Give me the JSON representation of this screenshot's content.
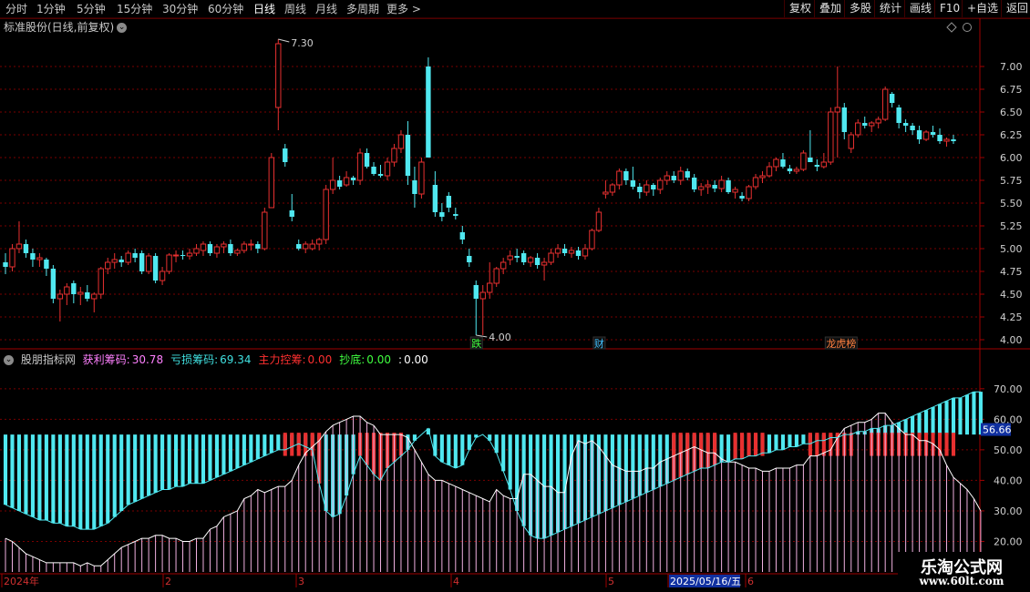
{
  "toolbar": {
    "periods": [
      "分时",
      "1分钟",
      "5分钟",
      "15分钟",
      "30分钟",
      "60分钟",
      "日线",
      "周线",
      "月线",
      "多周期",
      "更多 >"
    ],
    "active_index": 6,
    "right_buttons": [
      "复权",
      "叠加",
      "多股",
      "统计",
      "画线",
      "F10",
      "+自选",
      "返回"
    ]
  },
  "stock": {
    "title": "标准股份(日线,前复权)"
  },
  "indicator": {
    "name": "股朋指标网",
    "items": [
      {
        "label": "获利筹码:",
        "value": "30.78",
        "color": "#ff80ff"
      },
      {
        "label": "亏损筹码:",
        "value": "69.34",
        "color": "#40e0e0"
      },
      {
        "label": "主力控筹:",
        "value": "0.00",
        "color": "#ff3030"
      },
      {
        "label": "抄底:",
        "value": "0.00",
        "color": "#40ff40"
      },
      {
        "label": ":",
        "value": "0.00",
        "color": "#ffffff"
      }
    ],
    "current_value_tag": "56.66"
  },
  "markers": {
    "max_label": "7.30",
    "min_label": "4.00"
  },
  "event_tags": [
    {
      "text": "跌",
      "color": "#40ff40"
    },
    {
      "text": "财",
      "color": "#40c0ff"
    },
    {
      "text": "龙虎榜",
      "color": "#ff8040"
    }
  ],
  "time_axis": {
    "labels": [
      "2024年",
      "2",
      "3",
      "4",
      "5",
      "2025/05/16/五",
      "6"
    ]
  },
  "watermark": {
    "title": "乐淘公式网",
    "url": "www.60lt.com"
  },
  "chart_data": [
    {
      "type": "candlestick",
      "title": "标准股份(日线,前复权)",
      "y_ticks": [
        4.0,
        4.25,
        4.5,
        4.75,
        5.0,
        5.25,
        5.5,
        5.75,
        6.0,
        6.25,
        6.5,
        6.75,
        7.0
      ],
      "ylim": [
        3.93,
        7.35
      ],
      "candles": [
        [
          4.85,
          4.95,
          4.72,
          4.8
        ],
        [
          4.8,
          5.05,
          4.75,
          5.0
        ],
        [
          5.0,
          5.3,
          4.95,
          5.05
        ],
        [
          5.05,
          5.1,
          4.9,
          4.95
        ],
        [
          4.95,
          5.0,
          4.8,
          4.88
        ],
        [
          4.88,
          4.95,
          4.8,
          4.9
        ],
        [
          4.88,
          4.9,
          4.7,
          4.78
        ],
        [
          4.78,
          4.82,
          4.4,
          4.45
        ],
        [
          4.45,
          4.55,
          4.2,
          4.5
        ],
        [
          4.5,
          4.62,
          4.38,
          4.58
        ],
        [
          4.62,
          4.65,
          4.4,
          4.5
        ],
        [
          4.5,
          4.58,
          4.38,
          4.52
        ],
        [
          4.52,
          4.6,
          4.42,
          4.45
        ],
        [
          4.45,
          4.52,
          4.3,
          4.5
        ],
        [
          4.5,
          4.8,
          4.45,
          4.78
        ],
        [
          4.78,
          4.9,
          4.72,
          4.85
        ],
        [
          4.85,
          4.95,
          4.78,
          4.88
        ],
        [
          4.88,
          4.92,
          4.8,
          4.85
        ],
        [
          4.85,
          4.98,
          4.82,
          4.95
        ],
        [
          4.95,
          5.0,
          4.85,
          4.9
        ],
        [
          4.95,
          4.98,
          4.72,
          4.75
        ],
        [
          4.75,
          4.95,
          4.72,
          4.92
        ],
        [
          4.92,
          4.95,
          4.62,
          4.65
        ],
        [
          4.65,
          4.8,
          4.6,
          4.75
        ],
        [
          4.75,
          4.95,
          4.72,
          4.93
        ],
        [
          4.92,
          4.98,
          4.85,
          4.93
        ],
        [
          4.93,
          4.98,
          4.88,
          4.92
        ],
        [
          4.92,
          5.0,
          4.88,
          4.95
        ],
        [
          4.95,
          5.05,
          4.92,
          5.0
        ],
        [
          4.98,
          5.08,
          4.92,
          5.05
        ],
        [
          5.05,
          5.08,
          4.92,
          4.95
        ],
        [
          4.95,
          5.05,
          4.9,
          5.02
        ],
        [
          5.02,
          5.08,
          4.95,
          5.05
        ],
        [
          5.05,
          5.1,
          4.92,
          4.95
        ],
        [
          4.95,
          5.0,
          4.92,
          4.98
        ],
        [
          4.98,
          5.08,
          4.95,
          5.05
        ],
        [
          5.05,
          5.1,
          4.98,
          5.05
        ],
        [
          5.05,
          5.08,
          4.95,
          5.0
        ],
        [
          5.0,
          5.45,
          4.98,
          5.4
        ],
        [
          5.45,
          6.05,
          5.45,
          6.0
        ],
        [
          6.55,
          7.3,
          6.3,
          7.25
        ],
        [
          6.1,
          6.15,
          5.9,
          5.95
        ],
        [
          5.42,
          5.6,
          5.3,
          5.35
        ],
        [
          5.05,
          5.1,
          4.98,
          5.0
        ],
        [
          5.0,
          5.08,
          4.95,
          5.05
        ],
        [
          5.0,
          5.1,
          4.98,
          5.05
        ],
        [
          5.05,
          5.12,
          4.98,
          5.1
        ],
        [
          5.1,
          5.7,
          5.05,
          5.65
        ],
        [
          5.65,
          6.0,
          5.6,
          5.75
        ],
        [
          5.75,
          5.8,
          5.65,
          5.68
        ],
        [
          5.7,
          5.85,
          5.68,
          5.78
        ],
        [
          5.78,
          5.8,
          5.7,
          5.75
        ],
        [
          5.75,
          6.1,
          5.7,
          6.05
        ],
        [
          6.05,
          6.1,
          5.88,
          5.9
        ],
        [
          5.9,
          5.95,
          5.8,
          5.82
        ],
        [
          5.82,
          5.92,
          5.78,
          5.8
        ],
        [
          5.8,
          6.0,
          5.75,
          5.95
        ],
        [
          5.95,
          6.15,
          5.9,
          6.1
        ],
        [
          6.1,
          6.3,
          6.05,
          6.25
        ],
        [
          6.25,
          6.4,
          5.7,
          5.8
        ],
        [
          5.75,
          5.9,
          5.45,
          5.6
        ],
        [
          5.6,
          6.0,
          5.55,
          5.95
        ],
        [
          7.0,
          7.1,
          6.0,
          6.0
        ],
        [
          5.7,
          5.85,
          5.35,
          5.4
        ],
        [
          5.4,
          5.5,
          5.3,
          5.35
        ],
        [
          5.58,
          5.62,
          5.4,
          5.45
        ],
        [
          5.38,
          5.45,
          5.32,
          5.36
        ],
        [
          5.18,
          5.25,
          5.05,
          5.1
        ],
        [
          4.92,
          5.0,
          4.8,
          4.85
        ],
        [
          4.6,
          4.65,
          4.05,
          4.45
        ],
        [
          4.45,
          4.6,
          4.05,
          4.52
        ],
        [
          4.52,
          4.85,
          4.45,
          4.62
        ],
        [
          4.62,
          4.8,
          4.58,
          4.78
        ],
        [
          4.78,
          4.9,
          4.72,
          4.85
        ],
        [
          4.88,
          4.98,
          4.82,
          4.92
        ],
        [
          4.92,
          5.0,
          4.85,
          4.9
        ],
        [
          4.95,
          4.98,
          4.82,
          4.85
        ],
        [
          4.85,
          4.92,
          4.8,
          4.9
        ],
        [
          4.9,
          4.95,
          4.78,
          4.82
        ],
        [
          4.82,
          4.9,
          4.65,
          4.85
        ],
        [
          4.85,
          5.0,
          4.82,
          4.95
        ],
        [
          4.95,
          5.05,
          4.9,
          5.0
        ],
        [
          5.0,
          5.05,
          4.92,
          4.95
        ],
        [
          4.95,
          5.02,
          4.9,
          4.98
        ],
        [
          4.98,
          5.02,
          4.88,
          4.92
        ],
        [
          4.92,
          5.05,
          4.88,
          5.0
        ],
        [
          5.0,
          5.22,
          4.98,
          5.2
        ],
        [
          5.2,
          5.45,
          5.18,
          5.4
        ],
        [
          5.6,
          5.75,
          5.55,
          5.62
        ],
        [
          5.62,
          5.72,
          5.58,
          5.7
        ],
        [
          5.7,
          5.88,
          5.65,
          5.85
        ],
        [
          5.85,
          5.88,
          5.7,
          5.75
        ],
        [
          5.75,
          5.9,
          5.65,
          5.68
        ],
        [
          5.68,
          5.72,
          5.55,
          5.62
        ],
        [
          5.62,
          5.75,
          5.58,
          5.7
        ],
        [
          5.7,
          5.72,
          5.58,
          5.65
        ],
        [
          5.65,
          5.78,
          5.6,
          5.75
        ],
        [
          5.75,
          5.85,
          5.7,
          5.8
        ],
        [
          5.8,
          5.85,
          5.72,
          5.75
        ],
        [
          5.75,
          5.9,
          5.7,
          5.85
        ],
        [
          5.85,
          5.88,
          5.75,
          5.78
        ],
        [
          5.78,
          5.82,
          5.62,
          5.65
        ],
        [
          5.65,
          5.72,
          5.58,
          5.68
        ],
        [
          5.68,
          5.75,
          5.6,
          5.7
        ],
        [
          5.7,
          5.75,
          5.62,
          5.66
        ],
        [
          5.66,
          5.8,
          5.62,
          5.75
        ],
        [
          5.75,
          5.78,
          5.6,
          5.62
        ],
        [
          5.62,
          5.68,
          5.55,
          5.65
        ],
        [
          5.58,
          5.62,
          5.52,
          5.55
        ],
        [
          5.55,
          5.7,
          5.52,
          5.68
        ],
        [
          5.68,
          5.82,
          5.65,
          5.78
        ],
        [
          5.78,
          5.85,
          5.72,
          5.8
        ],
        [
          5.8,
          5.95,
          5.78,
          5.9
        ],
        [
          5.9,
          6.0,
          5.85,
          5.98
        ],
        [
          5.98,
          6.05,
          5.88,
          5.9
        ],
        [
          5.88,
          5.92,
          5.82,
          5.85
        ],
        [
          5.85,
          5.9,
          5.82,
          5.87
        ],
        [
          5.87,
          6.08,
          5.85,
          6.05
        ],
        [
          6.0,
          6.3,
          5.98,
          5.95
        ],
        [
          5.92,
          5.98,
          5.85,
          5.9
        ],
        [
          5.9,
          6.05,
          5.88,
          5.95
        ],
        [
          5.95,
          6.55,
          5.92,
          6.5
        ],
        [
          6.5,
          7.0,
          6.0,
          6.55
        ],
        [
          6.55,
          6.6,
          6.2,
          6.28
        ],
        [
          6.1,
          6.28,
          6.05,
          6.25
        ],
        [
          6.25,
          6.42,
          6.22,
          6.38
        ],
        [
          6.38,
          6.45,
          6.32,
          6.35
        ],
        [
          6.35,
          6.4,
          6.28,
          6.38
        ],
        [
          6.38,
          6.45,
          6.32,
          6.42
        ],
        [
          6.42,
          6.78,
          6.4,
          6.75
        ],
        [
          6.7,
          6.72,
          6.55,
          6.6
        ],
        [
          6.55,
          6.58,
          6.32,
          6.38
        ],
        [
          6.38,
          6.42,
          6.28,
          6.35
        ],
        [
          6.35,
          6.38,
          6.25,
          6.3
        ],
        [
          6.3,
          6.35,
          6.15,
          6.2
        ],
        [
          6.2,
          6.3,
          6.18,
          6.28
        ],
        [
          6.28,
          6.35,
          6.22,
          6.25
        ],
        [
          6.25,
          6.32,
          6.15,
          6.18
        ],
        [
          6.18,
          6.22,
          6.12,
          6.2
        ],
        [
          6.2,
          6.25,
          6.15,
          6.18
        ]
      ]
    },
    {
      "type": "indicator",
      "title": "股朋指标网",
      "y_ticks": [
        20.0,
        30.0,
        40.0,
        50.0,
        60.0,
        70.0
      ],
      "ylim": [
        10,
        78
      ],
      "series": [
        {
          "name": "获利筹码",
          "values": [
            21,
            20,
            18,
            16,
            15,
            14,
            13,
            13,
            13,
            13,
            13,
            12,
            13,
            12,
            12,
            14,
            16,
            18,
            19,
            20,
            21,
            21,
            22,
            22,
            21,
            21,
            20,
            20,
            21,
            21,
            24,
            25,
            28,
            29,
            30,
            34,
            35,
            37,
            36,
            37,
            38,
            38,
            40,
            45,
            49,
            51,
            53,
            56,
            58,
            59,
            60,
            61,
            61,
            59,
            58,
            55,
            55,
            55,
            55,
            54,
            50,
            46,
            42,
            40,
            40,
            39,
            38,
            37,
            36,
            35,
            34,
            33,
            37,
            35,
            34,
            34,
            42,
            42,
            40,
            38,
            38,
            36,
            36,
            48,
            53,
            52,
            53,
            51,
            48,
            45,
            44,
            43,
            43,
            43,
            44,
            44,
            46,
            47,
            48,
            49,
            50,
            51,
            50,
            49,
            49,
            47,
            46,
            46,
            45,
            44,
            44,
            43,
            43,
            44,
            44,
            44,
            45,
            45,
            48,
            48,
            49,
            50,
            54,
            57,
            58,
            59,
            59,
            60,
            62,
            62,
            59,
            57,
            55,
            55,
            53,
            53,
            52,
            50,
            45,
            41,
            39,
            37,
            34,
            30
          ]
        },
        {
          "name": "亏损筹码",
          "values": [
            32,
            31,
            30,
            29,
            28,
            27,
            27,
            26,
            26,
            25,
            25,
            24,
            24,
            24,
            25,
            26,
            28,
            30,
            32,
            33,
            34,
            35,
            36,
            37,
            37,
            38,
            38,
            39,
            39,
            39,
            40,
            41,
            42,
            43,
            44,
            45,
            46,
            47,
            48,
            49,
            50,
            50,
            51,
            52,
            51,
            50,
            39,
            30,
            28,
            29,
            35,
            42,
            48,
            45,
            42,
            40,
            44,
            46,
            48,
            50,
            53,
            55,
            57,
            48,
            46,
            45,
            44,
            45,
            50,
            54,
            55,
            53,
            49,
            43,
            37,
            30,
            25,
            22,
            21,
            21,
            22,
            23,
            24,
            25,
            26,
            27,
            28,
            29,
            30,
            31,
            32,
            33,
            34,
            35,
            36,
            37,
            38,
            39,
            40,
            41,
            42,
            43,
            44,
            44,
            45,
            46,
            46,
            47,
            47,
            48,
            48,
            49,
            49,
            50,
            50,
            51,
            51,
            52,
            52,
            53,
            53,
            54,
            54,
            55,
            55,
            56,
            56,
            57,
            57,
            58,
            58,
            59,
            60,
            61,
            62,
            63,
            64,
            65,
            66,
            67,
            67,
            68,
            69,
            69
          ]
        }
      ]
    }
  ]
}
